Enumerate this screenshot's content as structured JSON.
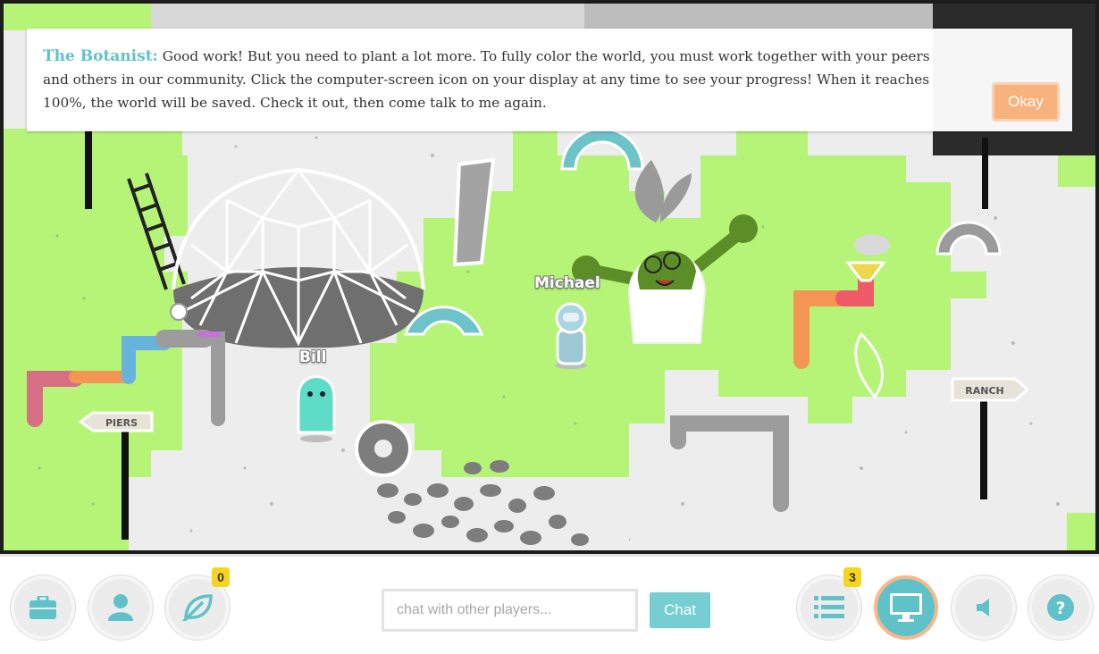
{
  "dialog": {
    "speaker": "The Botanist:",
    "message": "Good work! But you need to plant a lot more. To fully color the world, you must work together with your peers and others in our community. Click the computer-screen icon on your display at any time to see your progress! When it reaches 100%, the world will be saved. Check it out, then come talk to me again.",
    "okay_label": "Okay"
  },
  "world": {
    "players": [
      {
        "name": "Michael"
      },
      {
        "name": "Bill"
      }
    ],
    "signs": {
      "piers": "PIERS",
      "ranch": "RANCH"
    }
  },
  "toolbar": {
    "plants_badge": "0",
    "quests_badge": "3",
    "chat_placeholder": "chat with other players...",
    "chat_label": "Chat"
  },
  "colors": {
    "grass": "#b6f477",
    "ground": "#ededed",
    "accent_teal": "#5fc2c8",
    "accent_orange": "#f8b27d",
    "badge": "#f7d51c"
  },
  "icons": [
    "briefcase-icon",
    "person-icon",
    "leaf-icon",
    "list-icon",
    "monitor-icon",
    "speaker-icon",
    "help-icon"
  ]
}
